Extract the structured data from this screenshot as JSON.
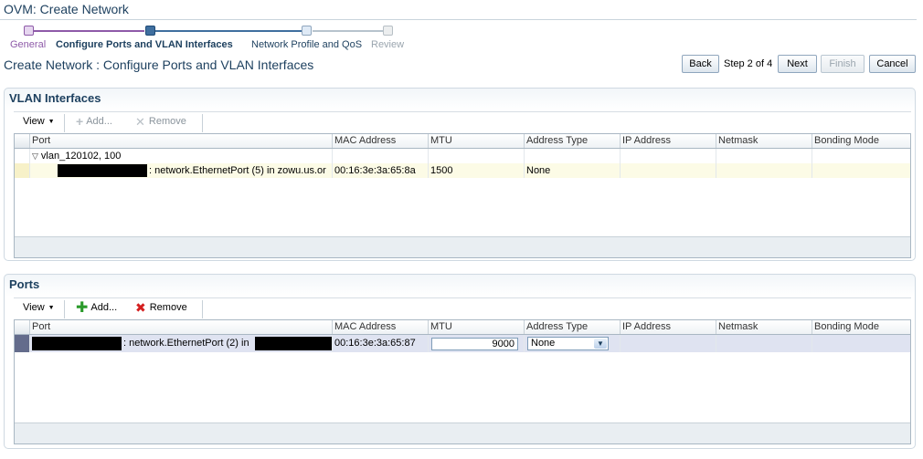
{
  "window": {
    "title": "OVM: Create Network"
  },
  "train": {
    "steps": [
      {
        "label": "General",
        "state": "visited"
      },
      {
        "label": "Configure Ports and VLAN Interfaces",
        "state": "current"
      },
      {
        "label": "Network Profile and QoS",
        "state": "next"
      },
      {
        "label": "Review",
        "state": "disabled"
      }
    ]
  },
  "page": {
    "subtitle": "Create Network : Configure Ports and VLAN Interfaces"
  },
  "nav": {
    "back": "Back",
    "step_info": "Step 2 of 4",
    "next": "Next",
    "finish": "Finish",
    "cancel": "Cancel"
  },
  "vlan": {
    "title": "VLAN Interfaces",
    "toolbar": {
      "view": "View",
      "add": "Add...",
      "remove": "Remove"
    },
    "columns": [
      "Port",
      "MAC Address",
      "MTU",
      "Address Type",
      "IP Address",
      "Netmask",
      "Bonding Mode"
    ],
    "group_row": "vlan_120102, 100",
    "row": {
      "port_text": ": network.EthernetPort (5) in zowu.us.or",
      "mac": "00:16:3e:3a:65:8a",
      "mtu": "1500",
      "address_type": "None",
      "ip": "",
      "netmask": "",
      "bonding": ""
    }
  },
  "ports": {
    "title": "Ports",
    "toolbar": {
      "view": "View",
      "add": "Add...",
      "remove": "Remove"
    },
    "columns": [
      "Port",
      "MAC Address",
      "MTU",
      "Address Type",
      "IP Address",
      "Netmask",
      "Bonding Mode"
    ],
    "row": {
      "port_text": ": network.EthernetPort (2) in",
      "mac": "00:16:3e:3a:65:87",
      "mtu": "9000",
      "address_type": "None",
      "ip": "",
      "netmask": "",
      "bonding": ""
    }
  },
  "colors": {
    "heading": "#1c3f5e",
    "train_visited": "#8e5aa8",
    "train_current": "#3f6f9f",
    "selected_row": "#dfe3f1",
    "highlight_row": "#fcfbe6",
    "add_icon": "#2a9a2a",
    "remove_icon": "#d41f1f"
  }
}
